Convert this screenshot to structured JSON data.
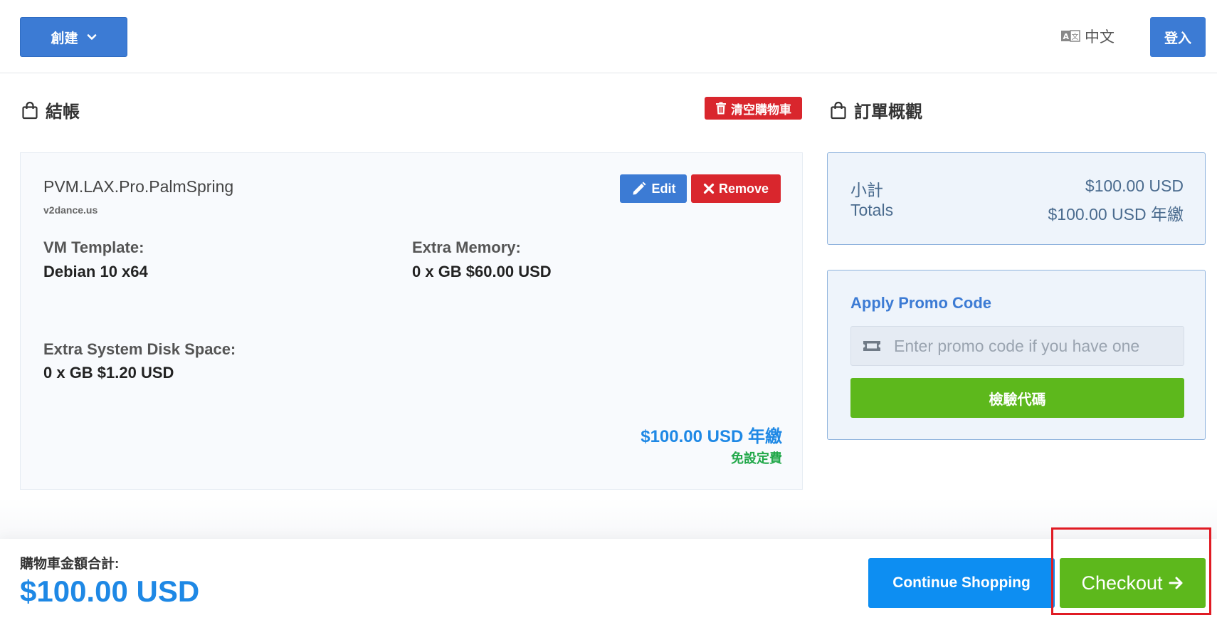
{
  "header": {
    "create_label": "創建",
    "language_label": "中文",
    "login_label": "登入"
  },
  "checkout": {
    "title": "結帳",
    "empty_cart_label": "清空購物車"
  },
  "item": {
    "name": "PVM.LAX.Pro.PalmSpring",
    "domain": "v2dance.us",
    "edit_label": "Edit",
    "remove_label": "Remove",
    "options": [
      {
        "label": "VM Template:",
        "value": "Debian 10 x64"
      },
      {
        "label": "Extra Memory:",
        "value": "0 x GB $60.00 USD"
      },
      {
        "label": "Extra System Disk Space:",
        "value": "0 x GB $1.20 USD"
      }
    ],
    "price": "$100.00 USD 年繳",
    "setup_fee": "免設定費"
  },
  "summary": {
    "title": "訂單概觀",
    "subtotal_label": "小計",
    "subtotal_value": "$100.00 USD",
    "totals_label": "Totals",
    "totals_value": "$100.00 USD 年繳"
  },
  "promo": {
    "title": "Apply Promo Code",
    "placeholder": "Enter promo code if you have one",
    "validate_label": "檢驗代碼"
  },
  "footer": {
    "total_label": "購物車金額合計:",
    "total_value": "$100.00 USD",
    "continue_label": "Continue Shopping",
    "checkout_label": "Checkout"
  },
  "icons": {
    "create_dropdown": "chevron-down-icon",
    "language": "translate-icon",
    "section": "shopping-bag-icon",
    "empty_cart": "trash-icon",
    "edit": "pencil-icon",
    "remove": "close-icon",
    "promo": "ticket-icon",
    "checkout": "arrow-right-icon"
  },
  "colors": {
    "primary": "#3c7bd4",
    "danger": "#d9262d",
    "success": "#5db81c",
    "price": "#1e88e5",
    "continue": "#0d8ef2",
    "highlight": "#e01b24"
  }
}
